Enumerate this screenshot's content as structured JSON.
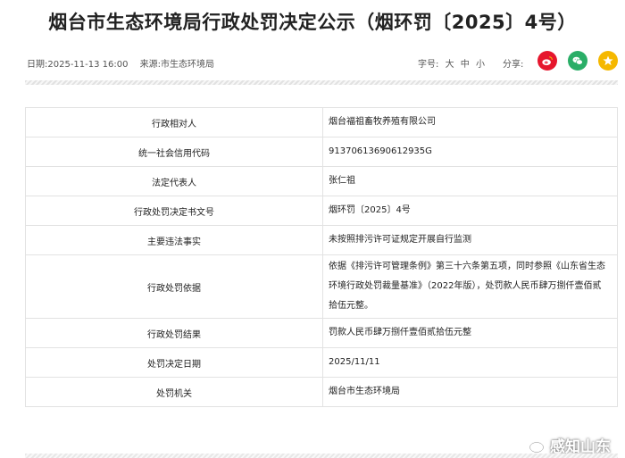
{
  "page": {
    "title": "烟台市生态环境局行政处罚决定公示（烟环罚〔2025〕4号）"
  },
  "meta": {
    "date": "日期:2025-11-13 16:00",
    "source": "来源:市生态环境局"
  },
  "font_size": {
    "label": "字号:",
    "large": "大",
    "medium": "中",
    "small": "小"
  },
  "share": {
    "label": "分享:",
    "buttons": [
      {
        "icon": "weibo-icon",
        "color": "#e6162d"
      },
      {
        "icon": "wechat-icon",
        "color": "#2aae67"
      },
      {
        "icon": "qzone-icon",
        "color": "#f5b800"
      }
    ]
  },
  "table": {
    "rows": [
      {
        "label": "行政相对人",
        "value": "烟台福祖畜牧养殖有限公司"
      },
      {
        "label": "统一社会信用代码",
        "value": "91370613690612935G"
      },
      {
        "label": "法定代表人",
        "value": "张仁祖"
      },
      {
        "label": "行政处罚决定书文号",
        "value": "烟环罚〔2025〕4号"
      },
      {
        "label": "主要违法事实",
        "value": "未按照排污许可证规定开展自行监测"
      },
      {
        "label": "行政处罚依据",
        "value": "依据《排污许可管理条例》第三十六条第五项，同时参照《山东省生态环境行政处罚裁量基准》（2022年版），处罚款人民币肆万捌仟壹佰贰拾伍元整。"
      },
      {
        "label": "行政处罚结果",
        "value": "罚款人民币肆万捌仟壹佰贰拾伍元整"
      },
      {
        "label": "处罚决定日期",
        "value": "2025/11/11"
      },
      {
        "label": "处罚机关",
        "value": "烟台市生态环境局"
      }
    ]
  },
  "watermark": {
    "text": "感知山东"
  }
}
